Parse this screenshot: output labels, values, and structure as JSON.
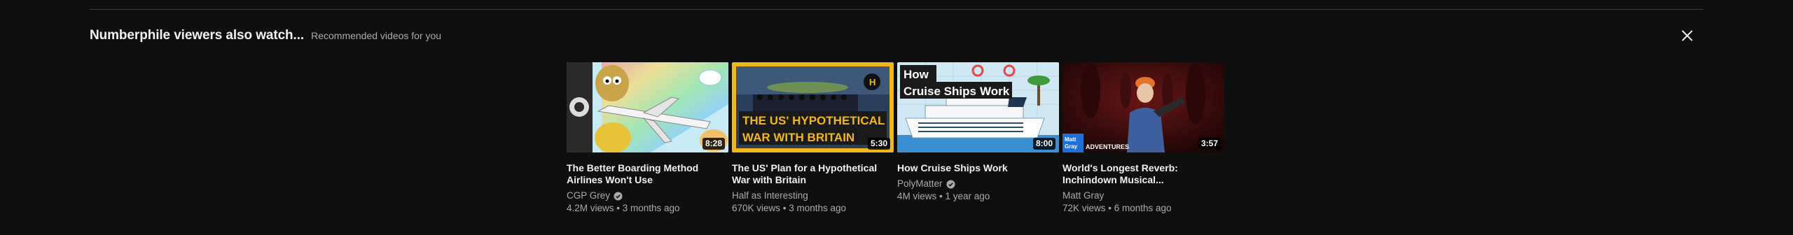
{
  "shelf": {
    "title": "Numberphile viewers also watch...",
    "subtitle": "Recommended videos for you",
    "close_icon": "close-icon"
  },
  "videos": [
    {
      "title": "The Better Boarding Method Airlines Won't Use",
      "channel": "CGP Grey",
      "verified": true,
      "meta": "4.2M views • 3 months ago",
      "duration": "8:28"
    },
    {
      "title": "The US' Plan for a Hypothetical War with Britain",
      "channel": "Half as Interesting",
      "verified": false,
      "meta": "670K views • 3 months ago",
      "duration": "5:30",
      "thumb_text": [
        "THE US' HYPOTHETICAL",
        "WAR WITH BRITAIN"
      ]
    },
    {
      "title": "How Cruise Ships Work",
      "channel": "PolyMatter",
      "verified": true,
      "meta": "4M views • 1 year ago",
      "duration": "8:00",
      "thumb_text": [
        "How",
        "Cruise Ships",
        "Work"
      ]
    },
    {
      "title": "World's Longest Reverb: Inchindown Musical...",
      "channel": "Matt Gray",
      "verified": false,
      "meta": "72K views • 6 months ago",
      "duration": "3:57",
      "thumb_text": [
        "Matt",
        "Gray",
        "ADVENTURES"
      ]
    }
  ],
  "colors": {
    "background": "#0f0f0f",
    "secondary_text": "#aaaaaa",
    "primary_text": "#f1f1f1"
  }
}
